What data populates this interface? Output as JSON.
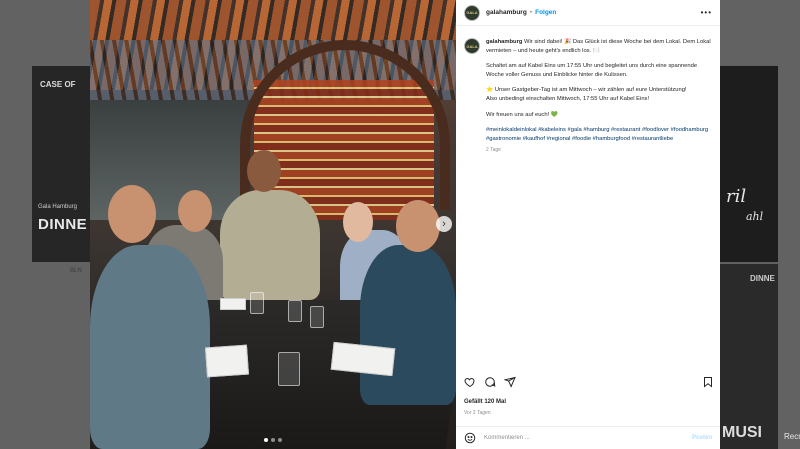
{
  "background": {
    "left_card": {
      "top_text": "CASE OF",
      "small_text": "Gala Hamburg",
      "title": "DINNE"
    },
    "left_text": "BLN",
    "right_card": {
      "script_line1": "ril",
      "script_line2": "ahl"
    },
    "right_card2": {
      "top_text": "DINNE",
      "bottom_text": "MUSI"
    },
    "right_label": "Recr"
  },
  "post": {
    "author": {
      "username": "galahamburg",
      "avatar_text": "GALA",
      "separator": "•",
      "follow_label": "Folgen",
      "more_label": "•••"
    },
    "caption": {
      "intro": "Wir sind dabei! 🎉",
      "lines": [
        "Das Glück ist diese Woche bei dem Lokal. Dem Lokal vermieten – und heute geht's endlich los. 🍽️",
        "Schaltet am auf Kabel Eins um 17:55 Uhr und begleitet uns durch eine spannende Woche voller Genuss und Einblicke hinter die Kulissen.",
        "⭐ Unser Gastgeber-Tag ist am Mittwoch – wir zählen auf eure Unterstützung!",
        "Also unbedingt einschalten Mittwoch, 17:55 Uhr auf Kabel Eins!",
        "Wir freuen uns auf euch! 💚"
      ],
      "hashtags": "#meinlokaldeinlokal #kabeleins #gala #hamburg #restaurant #foodlover #foodhamburg #gastronomie #kaufhof #regional #foodie #hamburgfood #restaurantliebe",
      "time_ago": "2 Tage"
    },
    "likes": "Gefällt 120 Mal",
    "date": "Vor 2 Tagen",
    "comment": {
      "placeholder": "Kommentieren ...",
      "post_label": "Posten"
    },
    "carousel": {
      "slide_count": 3,
      "active_index": 0,
      "next_label": "›"
    }
  }
}
